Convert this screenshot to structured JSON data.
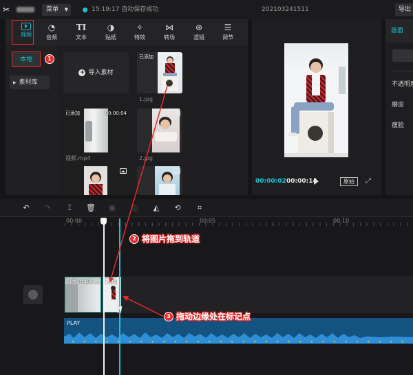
{
  "title_bar": {
    "menu_label": "菜单",
    "save_status": "15:19:17 自动保存成功",
    "project_name": "20210324151​1",
    "export_label": "导出",
    "accent_color": "#19c3d4"
  },
  "media_tabs": [
    {
      "label": "视频",
      "icon": "video-icon",
      "active": true
    },
    {
      "label": "音频",
      "icon": "audio-icon"
    },
    {
      "label": "文本",
      "icon": "text-icon",
      "glyph": "TI"
    },
    {
      "label": "贴纸",
      "icon": "sticker-icon"
    },
    {
      "label": "特效",
      "icon": "effects-icon"
    },
    {
      "label": "转场",
      "icon": "transition-icon"
    },
    {
      "label": "滤镜",
      "icon": "filter-icon"
    },
    {
      "label": "调节",
      "icon": "adjust-icon"
    }
  ],
  "sidebar": {
    "local_label": "本地",
    "library_label": "素材库"
  },
  "media": {
    "import_label": "导入素材",
    "added_tag": "已添加",
    "items": [
      {
        "name": "1.jpg",
        "added": true,
        "type": "image"
      },
      {
        "name": "视频.mp4",
        "added": true,
        "type": "video",
        "duration": "00:00:04"
      },
      {
        "name": "2.jpg",
        "added": false,
        "type": "image"
      }
    ]
  },
  "player": {
    "current_time": "00:00:02",
    "total_time": "00:00:14",
    "ratio_label": "原始"
  },
  "properties": {
    "tab_label": "画面",
    "labels": [
      "不透明度",
      "磨皮",
      "瘦脸"
    ]
  },
  "timeline": {
    "ticks": [
      "00:00",
      "00:05",
      "00:10"
    ],
    "video_clip_label": "视频.mp4",
    "image_clip_label": "1.jpg",
    "audio_label": "PLAY"
  },
  "annotations": {
    "badges": [
      "1",
      "2",
      "3"
    ],
    "step2": "将图片拖到轨道",
    "step3": "拖动边缘处在标记点",
    "color": "#e6292c"
  }
}
